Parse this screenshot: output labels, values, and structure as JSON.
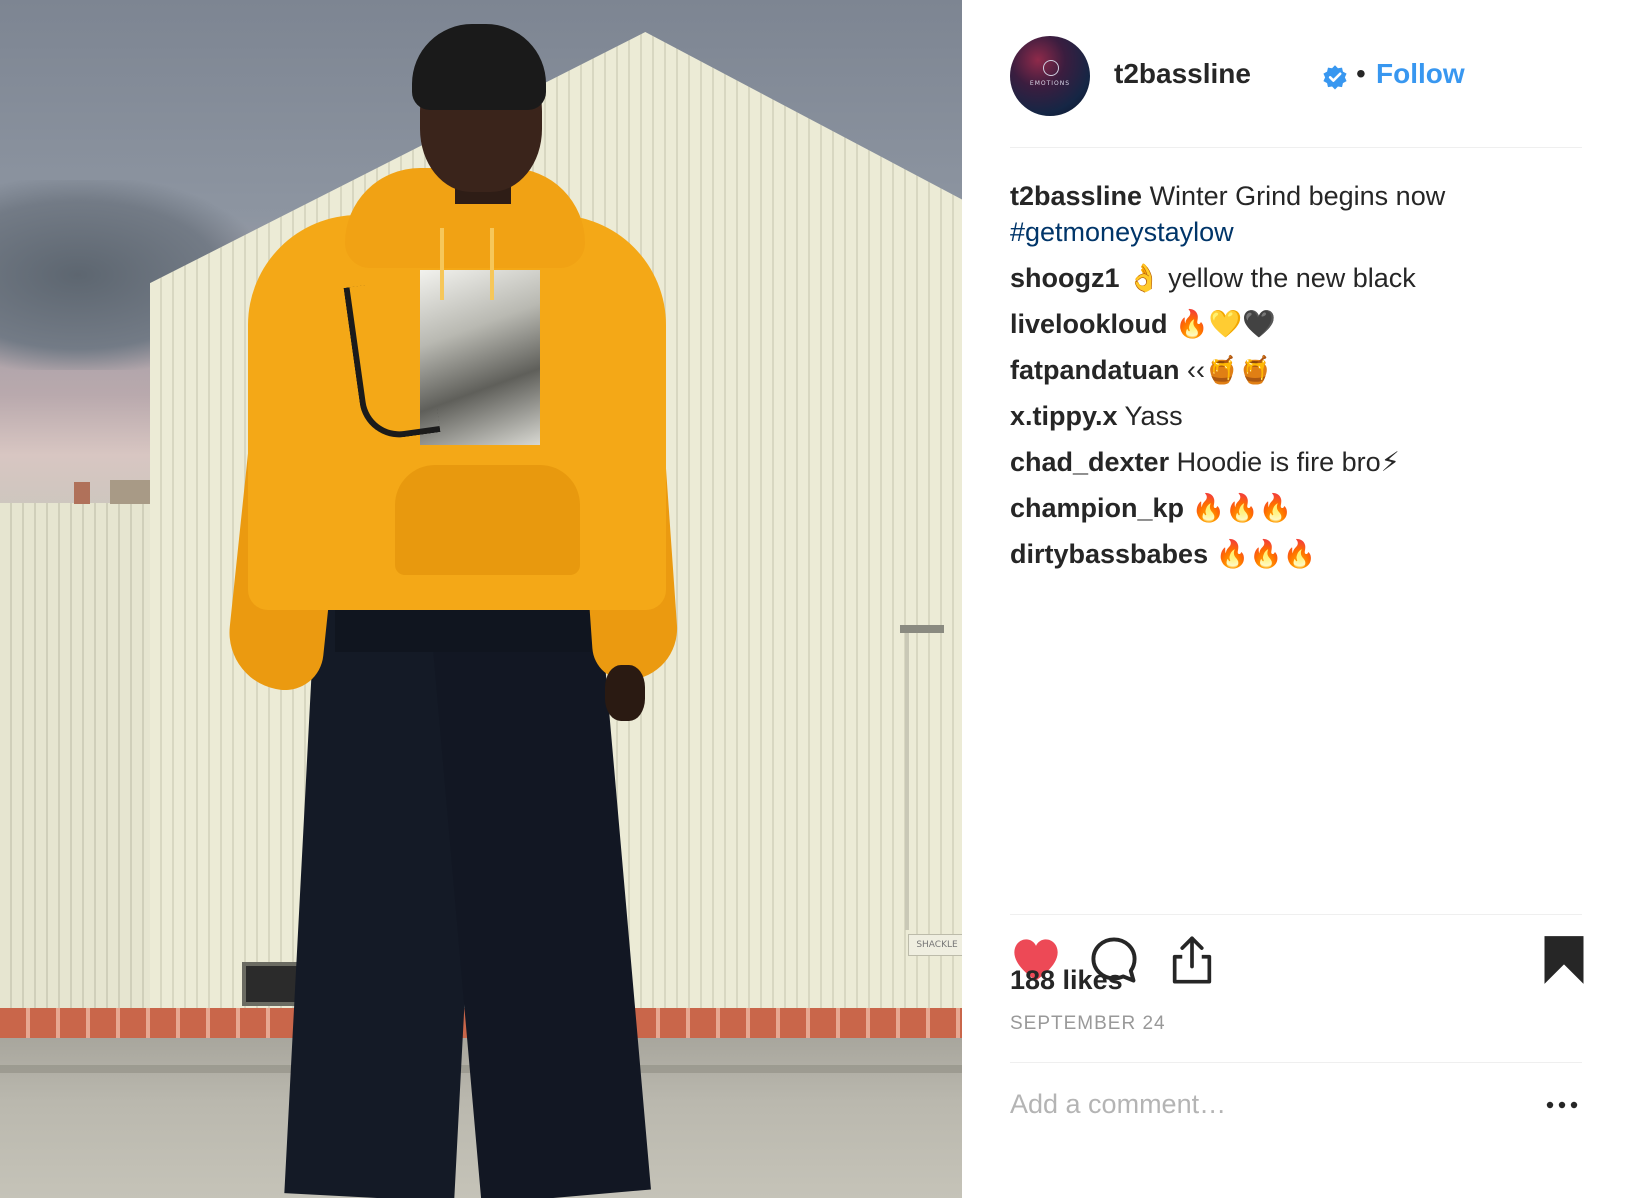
{
  "post": {
    "username": "t2bassline",
    "verified": true,
    "separator": "•",
    "follow_label": "Follow",
    "avatar_text": "EMOTIONS",
    "caption": {
      "username": "t2bassline",
      "text": "Winter Grind begins now",
      "hashtag": "#getmoneystaylow"
    },
    "comments": [
      {
        "username": "shoogz1",
        "text": "👌 yellow the new black"
      },
      {
        "username": "livelookloud",
        "text": "🔥💛🖤"
      },
      {
        "username": "fatpandatuan",
        "text": "‹‹🍯🍯"
      },
      {
        "username": "x.tippy.x",
        "text": "Yass"
      },
      {
        "username": "chad_dexter",
        "text": "Hoodie is fire bro⚡"
      },
      {
        "username": "champion_kp",
        "text": "🔥🔥🔥"
      },
      {
        "username": "dirtybassbabes",
        "text": "🔥🔥🔥"
      }
    ],
    "likes": "188 likes",
    "date": "SEPTEMBER 24",
    "add_comment_placeholder": "Add a comment…",
    "liked": true,
    "saved": true
  },
  "icons": {
    "like": "heart-filled-icon",
    "comment": "speech-bubble-icon",
    "share": "share-upload-icon",
    "save": "bookmark-filled-icon",
    "more": "ellipsis-icon",
    "verified": "verified-badge-icon"
  },
  "colors": {
    "like_red": "#ed4956",
    "follow_blue": "#3897f0",
    "verified_blue": "#3897f0",
    "hashtag_blue": "#003569",
    "hoodie_yellow": "#f4a817"
  },
  "photo": {
    "wall_label": "SHACKLE"
  }
}
